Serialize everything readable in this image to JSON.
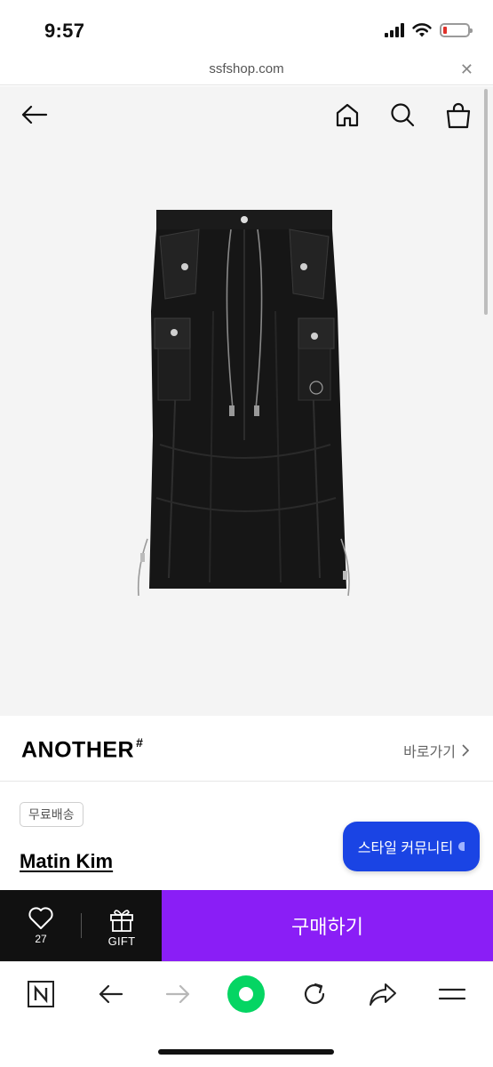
{
  "status_bar": {
    "time": "9:57",
    "battery_color": "#e0312a"
  },
  "url_bar": {
    "domain": "ssfshop.com",
    "close_icon": "close-icon"
  },
  "top_nav": {
    "icons": [
      "back-arrow-icon",
      "home-icon",
      "search-icon",
      "shopping-bag-icon"
    ]
  },
  "product_image": {
    "subject": "black cargo maxi skirt"
  },
  "brand": {
    "name": "ANOTHER",
    "mark": "#",
    "link_label": "바로가기"
  },
  "product": {
    "badge": "무료배송",
    "name": "Matin Kim"
  },
  "floating": {
    "style_community_label": "스타일 커뮤니티",
    "color": "#1a44e4"
  },
  "action_bar": {
    "like_count": "27",
    "gift_label": "GIFT",
    "buy_label": "구매하기",
    "buy_color": "#8a1ef6"
  },
  "browser_toolbar": {
    "icons": [
      "naver-n-icon",
      "back-icon",
      "forward-icon",
      "green-dot-icon",
      "reload-icon",
      "share-icon",
      "menu-icon"
    ]
  }
}
